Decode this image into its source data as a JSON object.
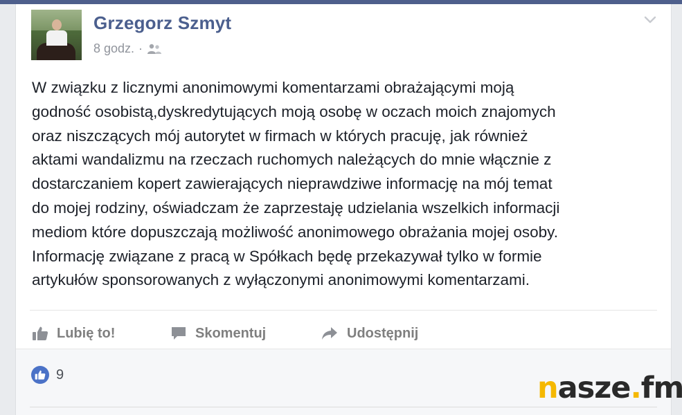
{
  "post": {
    "author": "Grzegorz Szmyt",
    "time": "8 godz.",
    "separator": "·",
    "audience_icon": "friends-icon",
    "menu_icon": "chevron-down-icon",
    "text_lines": [
      "W związku z licznymi anonimowymi komentarzami obrażającymi moją",
      "godność osobistą,dyskredytujących moją osobę w oczach moich znajomych",
      "oraz niszczących mój autorytet w firmach w których pracuję, jak również",
      "aktami wandalizmu na rzeczach ruchomych należących do mnie włącznie z",
      "dostarczaniem kopert zawierających nieprawdziwe informację na mój temat",
      "do mojej rodziny, oświadczam że zaprzestaję udzielania wszelkich informacji",
      "mediom które dopuszczają możliwość anonimowego obrażania mojej osoby.",
      "Informację związane z pracą w Spółkach będę przekazywał tylko w formie",
      "artykułów sponsorowanych z wyłączonymi anonimowymi komentarzami."
    ]
  },
  "actions": {
    "like": {
      "label": "Lubię to!",
      "icon": "thumbs-up-icon"
    },
    "comment": {
      "label": "Skomentuj",
      "icon": "speech-bubble-icon"
    },
    "share": {
      "label": "Udostępnij",
      "icon": "share-arrow-icon"
    }
  },
  "reactions": {
    "like_count": "9",
    "icon": "like-badge-icon"
  },
  "watermark": {
    "first": "n",
    "middle": "asze",
    "dot": ".",
    "last": "fm"
  },
  "colors": {
    "author": "#4b5f8e",
    "text": "#1d2129",
    "meta": "#90949c",
    "action": "#7f7f7f",
    "like_badge": "#4b72c7",
    "watermark_accent": "#f5b800"
  }
}
